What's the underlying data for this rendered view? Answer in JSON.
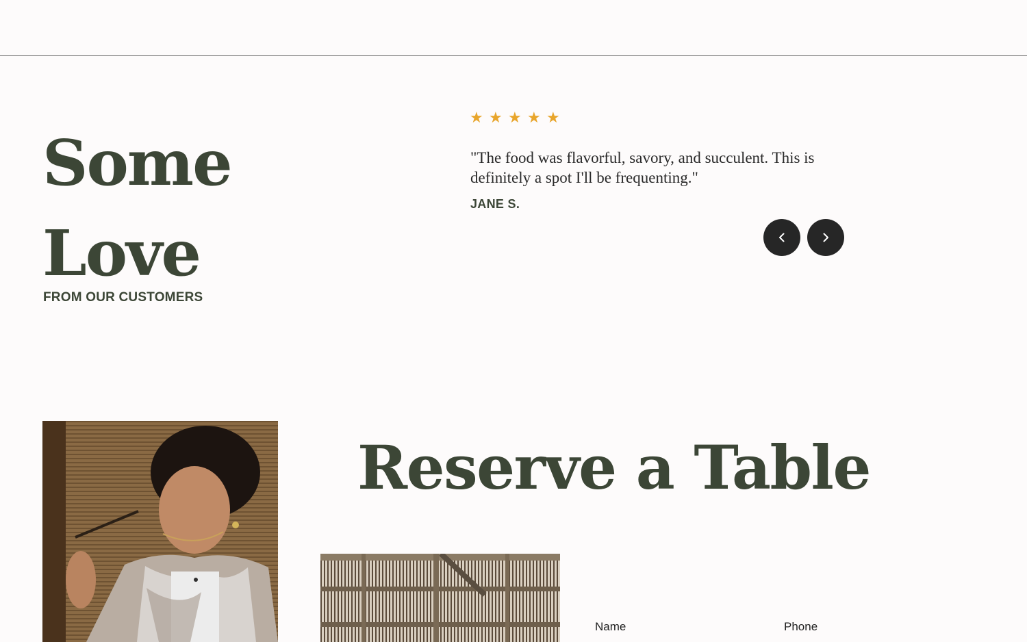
{
  "testimonials": {
    "heading_line1": "Some",
    "heading_line2": "Love",
    "subheading": "FROM OUR CUSTOMERS",
    "rating": 5,
    "star_color": "#e8a52b",
    "quote": "\"The food was flavorful, savory, and succulent. This is definitely a spot I'll be frequenting.\"",
    "author": "JANE S.",
    "prev_icon": "chevron-left-icon",
    "next_icon": "chevron-right-icon"
  },
  "reservation": {
    "title": "Reserve a Table",
    "fields": {
      "name_label": "Name",
      "phone_label": "Phone"
    }
  },
  "colors": {
    "heading": "#3c4636",
    "button_bg": "#262626",
    "background": "#fdfbfb"
  }
}
